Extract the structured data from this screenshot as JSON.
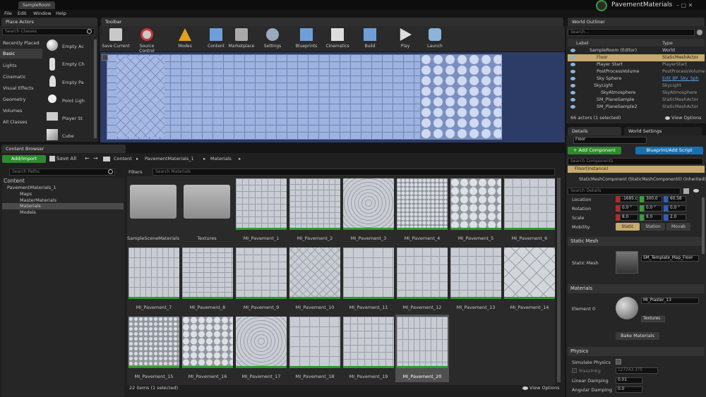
{
  "title_bar": {
    "tab": "SampleRoom",
    "project": "PavementMaterials"
  },
  "menu": [
    "File",
    "Edit",
    "Window",
    "Help"
  ],
  "place_actors": {
    "tab": "Place Actors",
    "search_placeholder": "Search Classes",
    "categories": [
      "Recently Placed",
      "Basic",
      "Lights",
      "Cinematic",
      "Visual Effects",
      "Geometry",
      "Volumes",
      "All Classes"
    ],
    "items": [
      "Empty Ac",
      "Empty Ch",
      "Empty Pa",
      "Point Ligh",
      "Player St",
      "Cube"
    ]
  },
  "toolbar": {
    "tab": "Toolbar",
    "buttons": [
      "Save Current",
      "Source Control",
      "Modes",
      "Content",
      "Marketplace",
      "Settings",
      "Blueprints",
      "Cinematics",
      "Build",
      "Play",
      "Launch"
    ]
  },
  "content_browser": {
    "tab": "Content Browser",
    "add_import": "Add/Import",
    "save_all": "Save All",
    "breadcrumb": [
      "Content",
      "PavementMaterials_1",
      "Materials"
    ],
    "search_paths": "Search Paths",
    "filters": "Filters",
    "search_materials": "Search Materials",
    "tree": [
      "Content",
      "PavementMaterials_1",
      "Maps",
      "MasterMaterials",
      "Materials",
      "Models"
    ],
    "assets": [
      "SampleSceneMaterials",
      "Textures",
      "MI_Pavement_1",
      "MI_Pavement_2",
      "MI_Pavement_3",
      "MI_Pavement_4",
      "MI_Pavement_5",
      "MI_Pavement_6",
      "MI_Pavement_7",
      "MI_Pavement_8",
      "MI_Pavement_9",
      "MI_Pavement_10",
      "MI_Pavement_11",
      "MI_Pavement_12",
      "MI_Pavement_13",
      "MI_Pavement_14",
      "MI_Pavement_15",
      "MI_Pavement_16",
      "MI_Pavement_17",
      "MI_Pavement_18",
      "MI_Pavement_19",
      "MI_Pavement_20"
    ],
    "status": "22 items (1 selected)",
    "view_options": "View Options"
  },
  "outliner": {
    "tab": "World Outliner",
    "search_placeholder": "Search...",
    "col_label": "Label",
    "col_type": "Type",
    "rows": [
      [
        "SampleRoom (Editor)",
        "World"
      ],
      [
        "Floor",
        "StaticMeshActor"
      ],
      [
        "Player Start",
        "PlayerStart"
      ],
      [
        "PostProcessVolume",
        "PostProcessVolume"
      ],
      [
        "Sky Sphere",
        "Edit BP_Sky_Sph"
      ],
      [
        "SkyLight",
        "SkyLight"
      ],
      [
        "SkyAtmosphere",
        "SkyAtmosphere"
      ],
      [
        "SM_PlaneSample",
        "StaticMeshActor"
      ],
      [
        "SM_PlaneSample2",
        "StaticMeshActor"
      ]
    ],
    "count": "66 actors (1 selected)",
    "view_options": "View Options"
  },
  "details": {
    "tab": "Details",
    "tab2": "World Settings",
    "name": "Floor",
    "add_component": "+ Add Component",
    "blueprint": "Blueprint/Add Script",
    "search_components": "Search Components",
    "instance": "Floor(Instance)",
    "component": "StaticMeshComponent (StaticMeshComponent0) (Inherited)",
    "search_details": "Search Details",
    "location_label": "Location",
    "location": [
      "-1695.c",
      "300.0",
      "60.58"
    ],
    "rotation_label": "Rotation",
    "rotation": [
      "0.0 °",
      "0.0 °",
      "0.0 °"
    ],
    "scale_label": "Scale",
    "scale": [
      "8.0",
      "8.0",
      "2.0"
    ],
    "mobility_label": "Mobility",
    "mobility": [
      "Static",
      "Station",
      "Movab"
    ],
    "static_mesh_cat": "Static Mesh",
    "static_mesh_label": "Static Mesh",
    "static_mesh_value": "SM_Template_Map_Floor",
    "materials_cat": "Materials",
    "element0": "Element 0",
    "material_value": "MI_Plaster_13",
    "textures": "Textures",
    "bake": "Bake Materials",
    "physics_cat": "Physics",
    "simulate": "Simulate Physics",
    "mass": "MassInKg",
    "mass_value": "127243.375",
    "linear": "Linear Damping",
    "linear_value": "0.01",
    "angular": "Angular Damping",
    "angular_value": "0.0"
  },
  "colors": {
    "accent_green": "#2d9c2d",
    "accent_blue": "#1a6fb0",
    "selection": "#c8a96e"
  }
}
